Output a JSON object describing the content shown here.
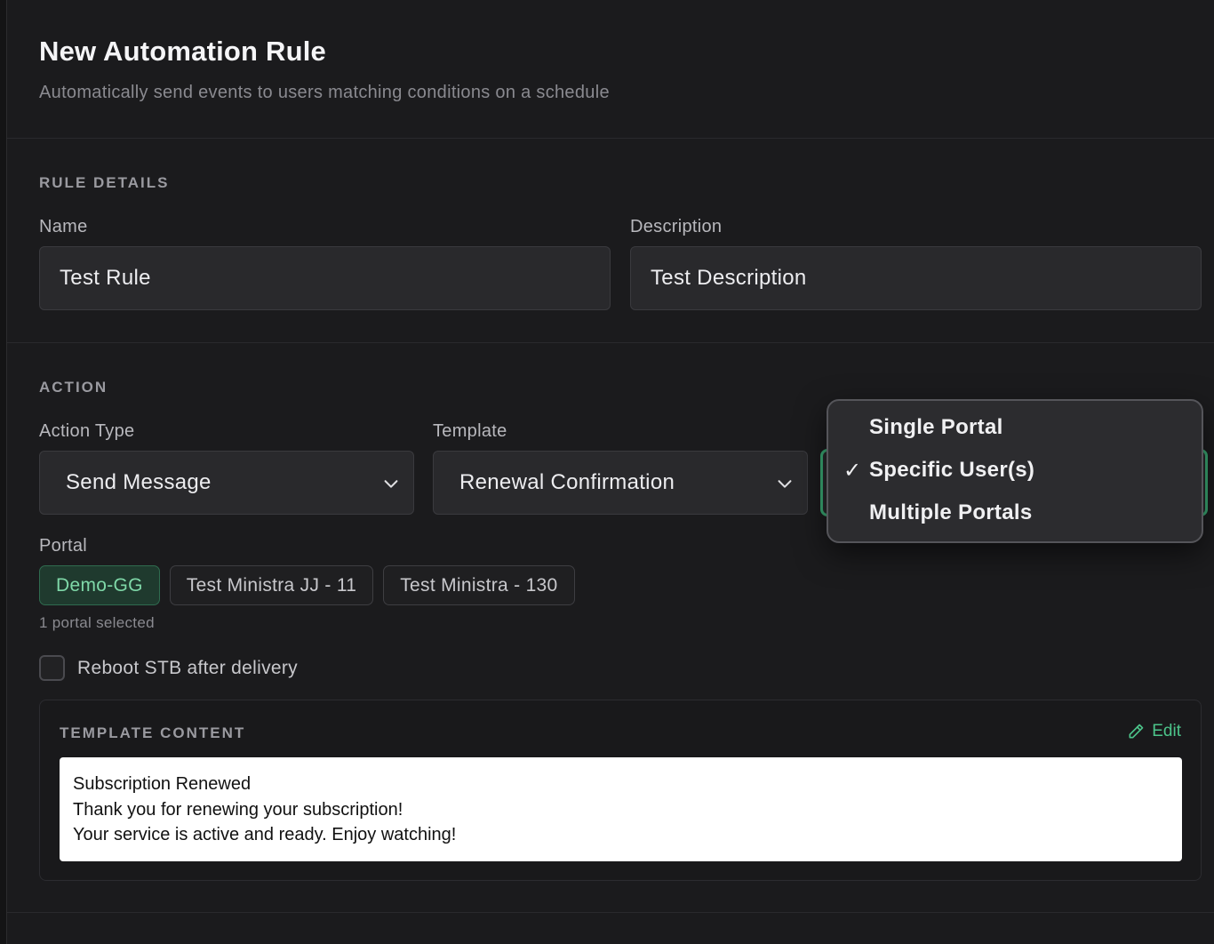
{
  "header": {
    "title": "New Automation Rule",
    "subtitle": "Automatically send events to users matching conditions on a schedule"
  },
  "rule_details": {
    "section_label": "RULE DETAILS",
    "name_label": "Name",
    "name_value": "Test Rule",
    "description_label": "Description",
    "description_value": "Test Description"
  },
  "action": {
    "section_label": "ACTION",
    "action_type_label": "Action Type",
    "action_type_value": "Send Message",
    "template_label": "Template",
    "template_value": "Renewal Confirmation",
    "portal_label": "Portal",
    "portals": [
      {
        "label": "Demo-GG",
        "selected": true
      },
      {
        "label": "Test Ministra JJ - 11",
        "selected": false
      },
      {
        "label": "Test Ministra - 130",
        "selected": false
      }
    ],
    "portal_hint": "1 portal selected",
    "reboot_label": "Reboot STB after delivery",
    "reboot_checked": false
  },
  "template_content": {
    "label": "TEMPLATE CONTENT",
    "edit_label": "Edit",
    "lines": [
      "Subscription Renewed",
      "Thank you for renewing your subscription!",
      "Your service is active and ready. Enjoy watching!"
    ]
  },
  "target_dropdown": {
    "options": [
      {
        "label": "Single Portal",
        "checked": false
      },
      {
        "label": "Specific User(s)",
        "checked": true
      },
      {
        "label": "Multiple Portals",
        "checked": false
      }
    ],
    "check_glyph": "✓"
  },
  "colors": {
    "accent": "#3aa873",
    "accent_text": "#7fd8a8",
    "background": "#1b1b1d"
  }
}
